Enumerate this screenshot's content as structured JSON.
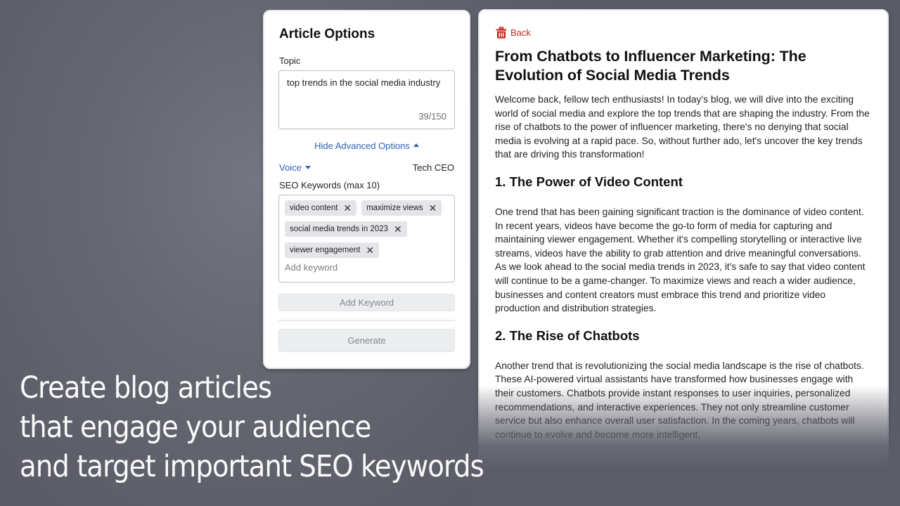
{
  "options_panel": {
    "title": "Article Options",
    "topic_label": "Topic",
    "topic_value": "top trends in the social media industry",
    "topic_char_count": "39/150",
    "advanced_toggle_label": "Hide Advanced Options",
    "voice_label": "Voice",
    "voice_value": "Tech CEO",
    "seo_label": "SEO Keywords (max 10)",
    "keywords": [
      {
        "label": "video content"
      },
      {
        "label": "maximize views"
      },
      {
        "label": "social media trends in 2023"
      },
      {
        "label": "viewer engagement"
      }
    ],
    "add_keyword_placeholder": "Add keyword",
    "add_keyword_button": "Add Keyword",
    "generate_button": "Generate"
  },
  "article": {
    "back_label": "Back",
    "title": "From Chatbots to Influencer Marketing: The Evolution of Social Media Trends",
    "intro": "Welcome back, fellow tech enthusiasts! In today's blog, we will dive into the exciting world of social media and explore the top trends that are shaping the industry. From the rise of chatbots to the power of influencer marketing, there's no denying that social media is evolving at a rapid pace. So, without further ado, let's uncover the key trends that are driving this transformation!",
    "sections": [
      {
        "heading": "1. The Power of Video Content",
        "body": "One trend that has been gaining significant traction is the dominance of video content. In recent years, videos have become the go-to form of media for capturing and maintaining viewer engagement. Whether it's compelling storytelling or interactive live streams, videos have the ability to grab attention and drive meaningful conversations. As we look ahead to the social media trends in 2023, it's safe to say that video content will continue to be a game-changer. To maximize views and reach a wider audience, businesses and content creators must embrace this trend and prioritize video production and distribution strategies."
      },
      {
        "heading": "2. The Rise of Chatbots",
        "body": "Another trend that is revolutionizing the social media landscape is the rise of chatbots. These AI-powered virtual assistants have transformed how businesses engage with their customers. Chatbots provide instant responses to user inquiries, personalized recommendations, and interactive experiences. They not only streamline customer service but also enhance overall user satisfaction. In the coming years, chatbots will continue to evolve and become more intelligent,"
      }
    ]
  },
  "tagline": {
    "lines": [
      "Create blog articles",
      "that engage your audience",
      "and target important SEO keywords"
    ]
  },
  "colors": {
    "link_blue": "#2b63b3",
    "back_red": "#c4281c",
    "background": "#5c5d68"
  }
}
